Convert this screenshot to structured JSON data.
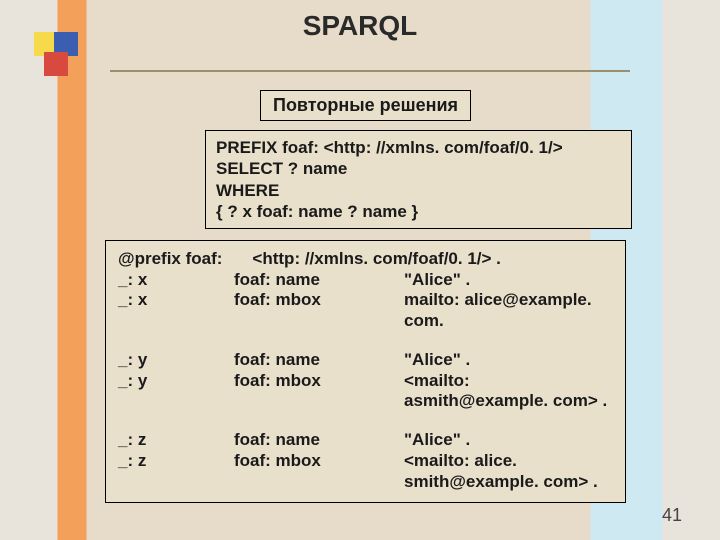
{
  "title": "SPARQL",
  "subtitle": "Повторные решения",
  "query": {
    "line1": "PREFIX foaf: <http: //xmlns. com/foaf/0. 1/>",
    "line2": "SELECT ? name",
    "line3": "WHERE",
    "line4": "{ ? x foaf: name ? name }"
  },
  "data": {
    "prefix_row": {
      "c1": "@prefix foaf:",
      "c2": "",
      "c3": "<http: //xmlns. com/foaf/0. 1/> ."
    },
    "x1": {
      "c1": " _: x",
      "c2": "foaf: name",
      "c3": "\"Alice\" ."
    },
    "x2": {
      "c1": " _: x",
      "c2": "foaf: mbox",
      "c3": "mailto: alice@example. com."
    },
    "y1": {
      "c1": " _: y",
      "c2": " foaf: name",
      "c3": "\"Alice\" ."
    },
    "y2": {
      "c1": "_: y",
      "c2": "foaf: mbox",
      "c3": "<mailto: asmith@example. com> ."
    },
    "z1": {
      "c1": "_: z",
      "c2": "foaf: name",
      "c3": " \"Alice\" ."
    },
    "z2": {
      "c1": "_: z",
      "c2": "foaf: mbox",
      "c3": "<mailto: alice. smith@example. com> ."
    }
  },
  "page_number": "41"
}
